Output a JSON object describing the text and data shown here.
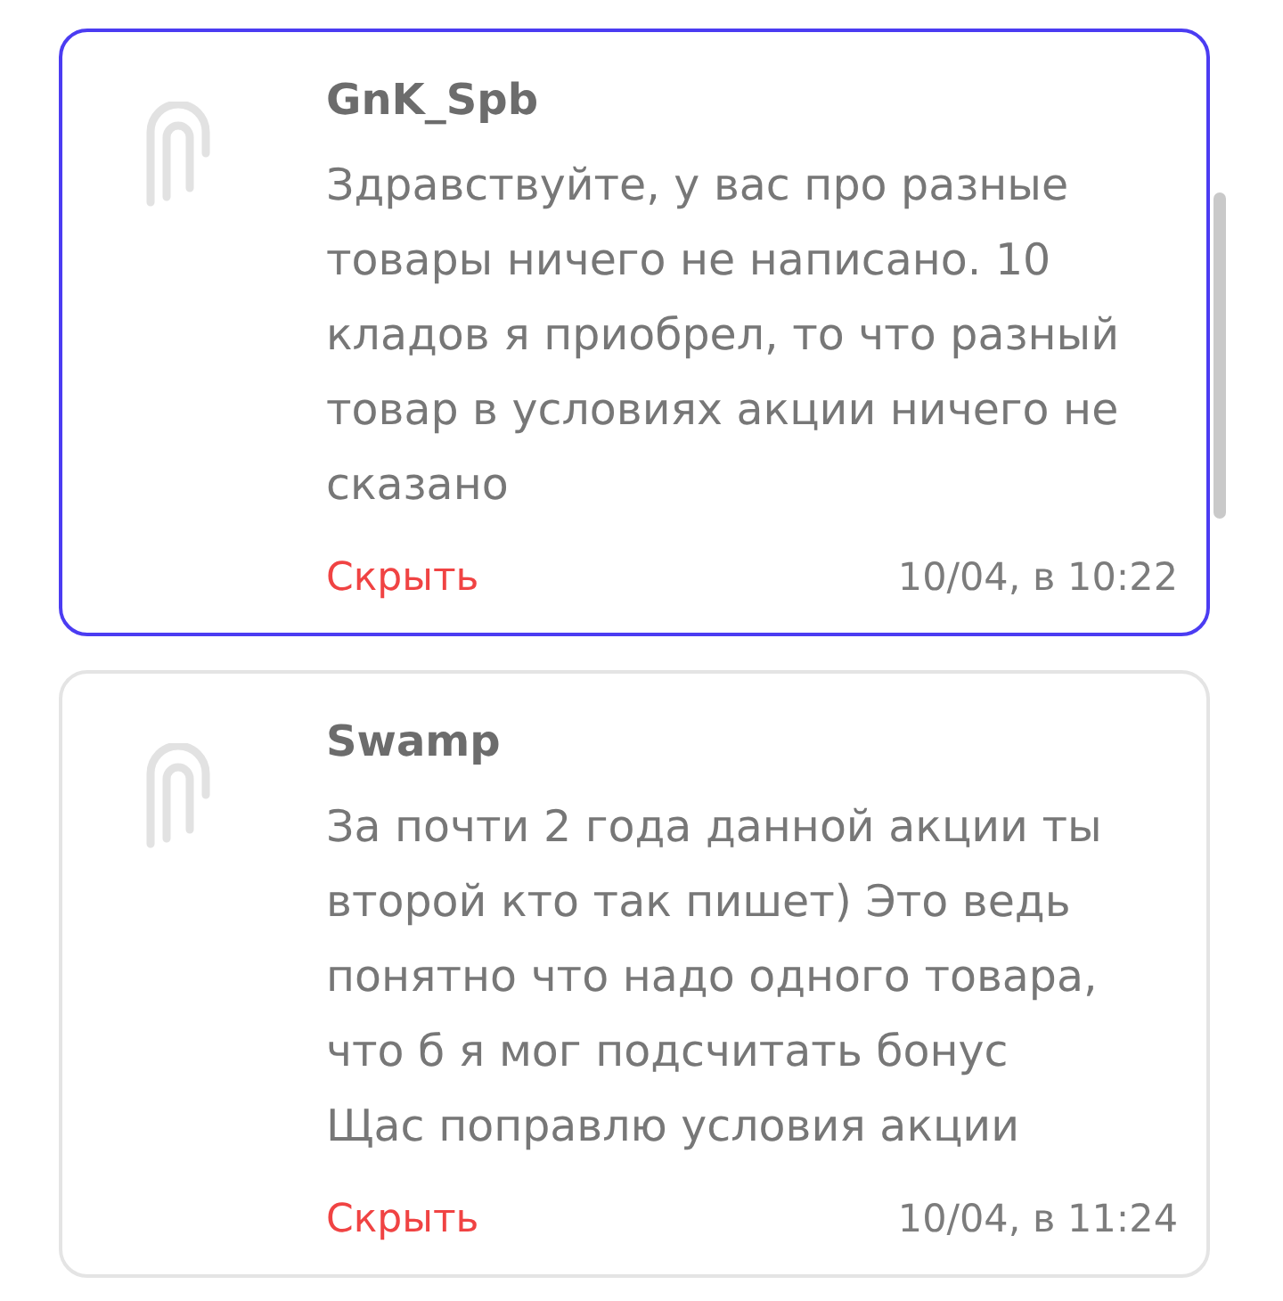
{
  "comments": [
    {
      "author": "GnK_Spb",
      "text": "Здравствуйте, у вас про разные товары ничего не написано. 10 кладов я приобрел, то что разный товар в условиях акции ничего не сказано",
      "hide_link": "Скрыть",
      "time": "10/04, в 10:22",
      "selected": true
    },
    {
      "author": "Swamp",
      "text": "За почти 2 года данной акции ты второй кто так пишет) Это ведь понятно что надо одного товара, что б я мог подсчитать бонус\nЩас поправлю условия акции",
      "hide_link": "Скрыть",
      "time": "10/04, в 11:24",
      "selected": false
    }
  ]
}
